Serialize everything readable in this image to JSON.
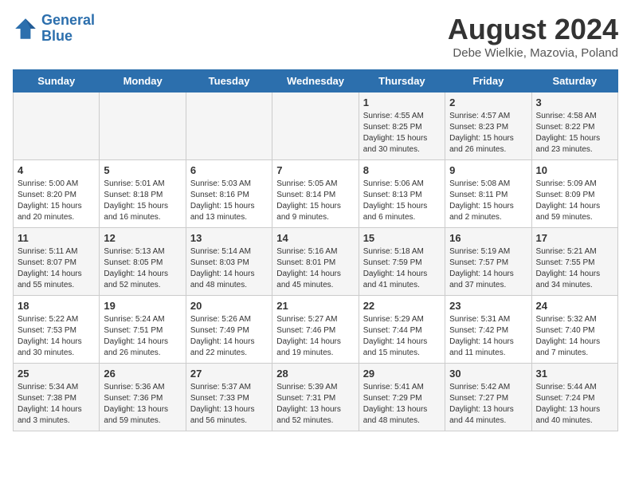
{
  "header": {
    "logo_line1": "General",
    "logo_line2": "Blue",
    "month_year": "August 2024",
    "location": "Debe Wielkie, Mazovia, Poland"
  },
  "days_of_week": [
    "Sunday",
    "Monday",
    "Tuesday",
    "Wednesday",
    "Thursday",
    "Friday",
    "Saturday"
  ],
  "weeks": [
    [
      {
        "day": "",
        "content": ""
      },
      {
        "day": "",
        "content": ""
      },
      {
        "day": "",
        "content": ""
      },
      {
        "day": "",
        "content": ""
      },
      {
        "day": "1",
        "content": "Sunrise: 4:55 AM\nSunset: 8:25 PM\nDaylight: 15 hours\nand 30 minutes."
      },
      {
        "day": "2",
        "content": "Sunrise: 4:57 AM\nSunset: 8:23 PM\nDaylight: 15 hours\nand 26 minutes."
      },
      {
        "day": "3",
        "content": "Sunrise: 4:58 AM\nSunset: 8:22 PM\nDaylight: 15 hours\nand 23 minutes."
      }
    ],
    [
      {
        "day": "4",
        "content": "Sunrise: 5:00 AM\nSunset: 8:20 PM\nDaylight: 15 hours\nand 20 minutes."
      },
      {
        "day": "5",
        "content": "Sunrise: 5:01 AM\nSunset: 8:18 PM\nDaylight: 15 hours\nand 16 minutes."
      },
      {
        "day": "6",
        "content": "Sunrise: 5:03 AM\nSunset: 8:16 PM\nDaylight: 15 hours\nand 13 minutes."
      },
      {
        "day": "7",
        "content": "Sunrise: 5:05 AM\nSunset: 8:14 PM\nDaylight: 15 hours\nand 9 minutes."
      },
      {
        "day": "8",
        "content": "Sunrise: 5:06 AM\nSunset: 8:13 PM\nDaylight: 15 hours\nand 6 minutes."
      },
      {
        "day": "9",
        "content": "Sunrise: 5:08 AM\nSunset: 8:11 PM\nDaylight: 15 hours\nand 2 minutes."
      },
      {
        "day": "10",
        "content": "Sunrise: 5:09 AM\nSunset: 8:09 PM\nDaylight: 14 hours\nand 59 minutes."
      }
    ],
    [
      {
        "day": "11",
        "content": "Sunrise: 5:11 AM\nSunset: 8:07 PM\nDaylight: 14 hours\nand 55 minutes."
      },
      {
        "day": "12",
        "content": "Sunrise: 5:13 AM\nSunset: 8:05 PM\nDaylight: 14 hours\nand 52 minutes."
      },
      {
        "day": "13",
        "content": "Sunrise: 5:14 AM\nSunset: 8:03 PM\nDaylight: 14 hours\nand 48 minutes."
      },
      {
        "day": "14",
        "content": "Sunrise: 5:16 AM\nSunset: 8:01 PM\nDaylight: 14 hours\nand 45 minutes."
      },
      {
        "day": "15",
        "content": "Sunrise: 5:18 AM\nSunset: 7:59 PM\nDaylight: 14 hours\nand 41 minutes."
      },
      {
        "day": "16",
        "content": "Sunrise: 5:19 AM\nSunset: 7:57 PM\nDaylight: 14 hours\nand 37 minutes."
      },
      {
        "day": "17",
        "content": "Sunrise: 5:21 AM\nSunset: 7:55 PM\nDaylight: 14 hours\nand 34 minutes."
      }
    ],
    [
      {
        "day": "18",
        "content": "Sunrise: 5:22 AM\nSunset: 7:53 PM\nDaylight: 14 hours\nand 30 minutes."
      },
      {
        "day": "19",
        "content": "Sunrise: 5:24 AM\nSunset: 7:51 PM\nDaylight: 14 hours\nand 26 minutes."
      },
      {
        "day": "20",
        "content": "Sunrise: 5:26 AM\nSunset: 7:49 PM\nDaylight: 14 hours\nand 22 minutes."
      },
      {
        "day": "21",
        "content": "Sunrise: 5:27 AM\nSunset: 7:46 PM\nDaylight: 14 hours\nand 19 minutes."
      },
      {
        "day": "22",
        "content": "Sunrise: 5:29 AM\nSunset: 7:44 PM\nDaylight: 14 hours\nand 15 minutes."
      },
      {
        "day": "23",
        "content": "Sunrise: 5:31 AM\nSunset: 7:42 PM\nDaylight: 14 hours\nand 11 minutes."
      },
      {
        "day": "24",
        "content": "Sunrise: 5:32 AM\nSunset: 7:40 PM\nDaylight: 14 hours\nand 7 minutes."
      }
    ],
    [
      {
        "day": "25",
        "content": "Sunrise: 5:34 AM\nSunset: 7:38 PM\nDaylight: 14 hours\nand 3 minutes."
      },
      {
        "day": "26",
        "content": "Sunrise: 5:36 AM\nSunset: 7:36 PM\nDaylight: 13 hours\nand 59 minutes."
      },
      {
        "day": "27",
        "content": "Sunrise: 5:37 AM\nSunset: 7:33 PM\nDaylight: 13 hours\nand 56 minutes."
      },
      {
        "day": "28",
        "content": "Sunrise: 5:39 AM\nSunset: 7:31 PM\nDaylight: 13 hours\nand 52 minutes."
      },
      {
        "day": "29",
        "content": "Sunrise: 5:41 AM\nSunset: 7:29 PM\nDaylight: 13 hours\nand 48 minutes."
      },
      {
        "day": "30",
        "content": "Sunrise: 5:42 AM\nSunset: 7:27 PM\nDaylight: 13 hours\nand 44 minutes."
      },
      {
        "day": "31",
        "content": "Sunrise: 5:44 AM\nSunset: 7:24 PM\nDaylight: 13 hours\nand 40 minutes."
      }
    ]
  ]
}
